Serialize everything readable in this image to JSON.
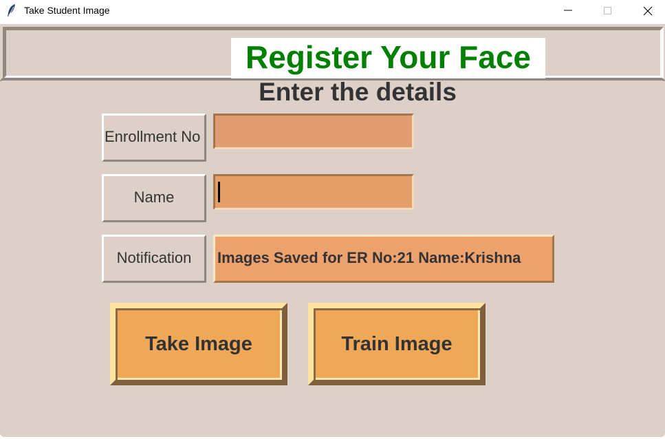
{
  "window": {
    "title": "Take Student Image",
    "icon": "feather-icon",
    "controls": [
      "minimize-icon",
      "maximize-icon",
      "close-icon"
    ]
  },
  "header": {
    "title": "Register Your Face",
    "title_color": "#008000"
  },
  "form": {
    "heading": "Enter the details",
    "enrollment_label": "Enrollment No",
    "enrollment_value": "",
    "name_label": "Name",
    "name_value": "",
    "notification_label": "Notification",
    "notification_text": "Images Saved for ER No:21 Name:Krishna"
  },
  "buttons": {
    "take_image": "Take Image",
    "train_image": "Train Image"
  },
  "colors": {
    "background": "#ddd0c8",
    "entry": "#e29c72",
    "notification": "#eda26e",
    "button": "#efa858"
  }
}
